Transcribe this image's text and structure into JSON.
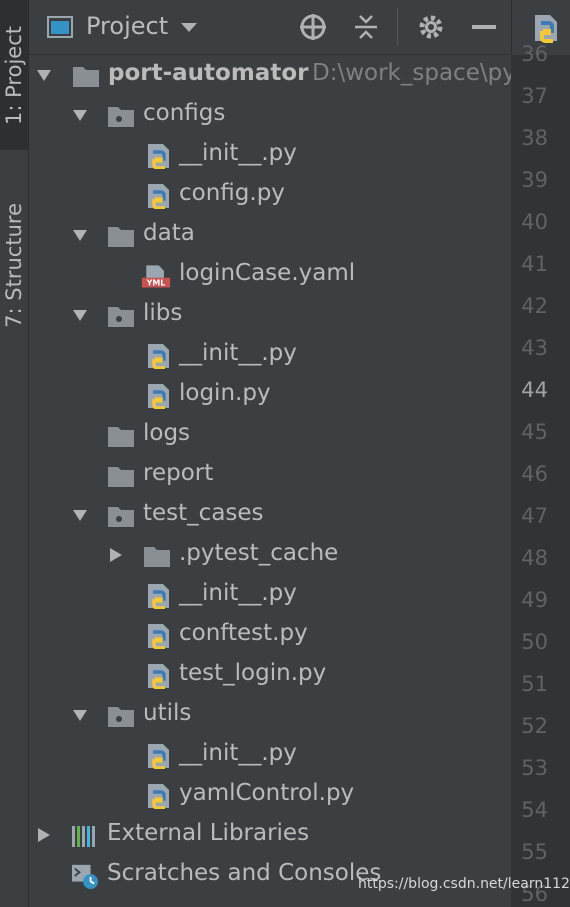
{
  "left_strip": {
    "project_tab": "1: Project",
    "structure_tab": "7: Structure"
  },
  "header": {
    "title": "Project",
    "icons": [
      "project-view-icon",
      "dropdown-icon",
      "locate-icon",
      "collapse-icon",
      "gear-icon",
      "hide-icon"
    ]
  },
  "tree": {
    "root_name": "port-automator",
    "root_path": "D:\\work_space\\py",
    "items": [
      {
        "label": "configs"
      },
      {
        "label": "__init__.py"
      },
      {
        "label": "config.py"
      },
      {
        "label": "data"
      },
      {
        "label": "loginCase.yaml"
      },
      {
        "label": "libs"
      },
      {
        "label": "__init__.py"
      },
      {
        "label": "login.py"
      },
      {
        "label": "logs"
      },
      {
        "label": "report"
      },
      {
        "label": "test_cases"
      },
      {
        "label": ".pytest_cache"
      },
      {
        "label": "__init__.py"
      },
      {
        "label": "conftest.py"
      },
      {
        "label": "test_login.py"
      },
      {
        "label": "utils"
      },
      {
        "label": "__init__.py"
      },
      {
        "label": "yamlControl.py"
      }
    ],
    "external_libraries": "External Libraries",
    "scratches": "Scratches and Consoles"
  },
  "gutter": {
    "lines": [
      "36",
      "37",
      "38",
      "39",
      "40",
      "41",
      "42",
      "43",
      "44",
      "45",
      "46",
      "47",
      "48",
      "49",
      "50",
      "51",
      "52",
      "53",
      "54",
      "55",
      "56"
    ],
    "current_line": "44"
  },
  "watermark": "https://blog.csdn.net/learn112",
  "colors": {
    "panel_bg": "#3c3f41",
    "gutter_bg": "#313335",
    "text": "#bbbbbb",
    "folder": "#8a8f93",
    "python_blue": "#3f7ab5",
    "python_yellow": "#f5c839",
    "yml_red": "#c75450"
  }
}
